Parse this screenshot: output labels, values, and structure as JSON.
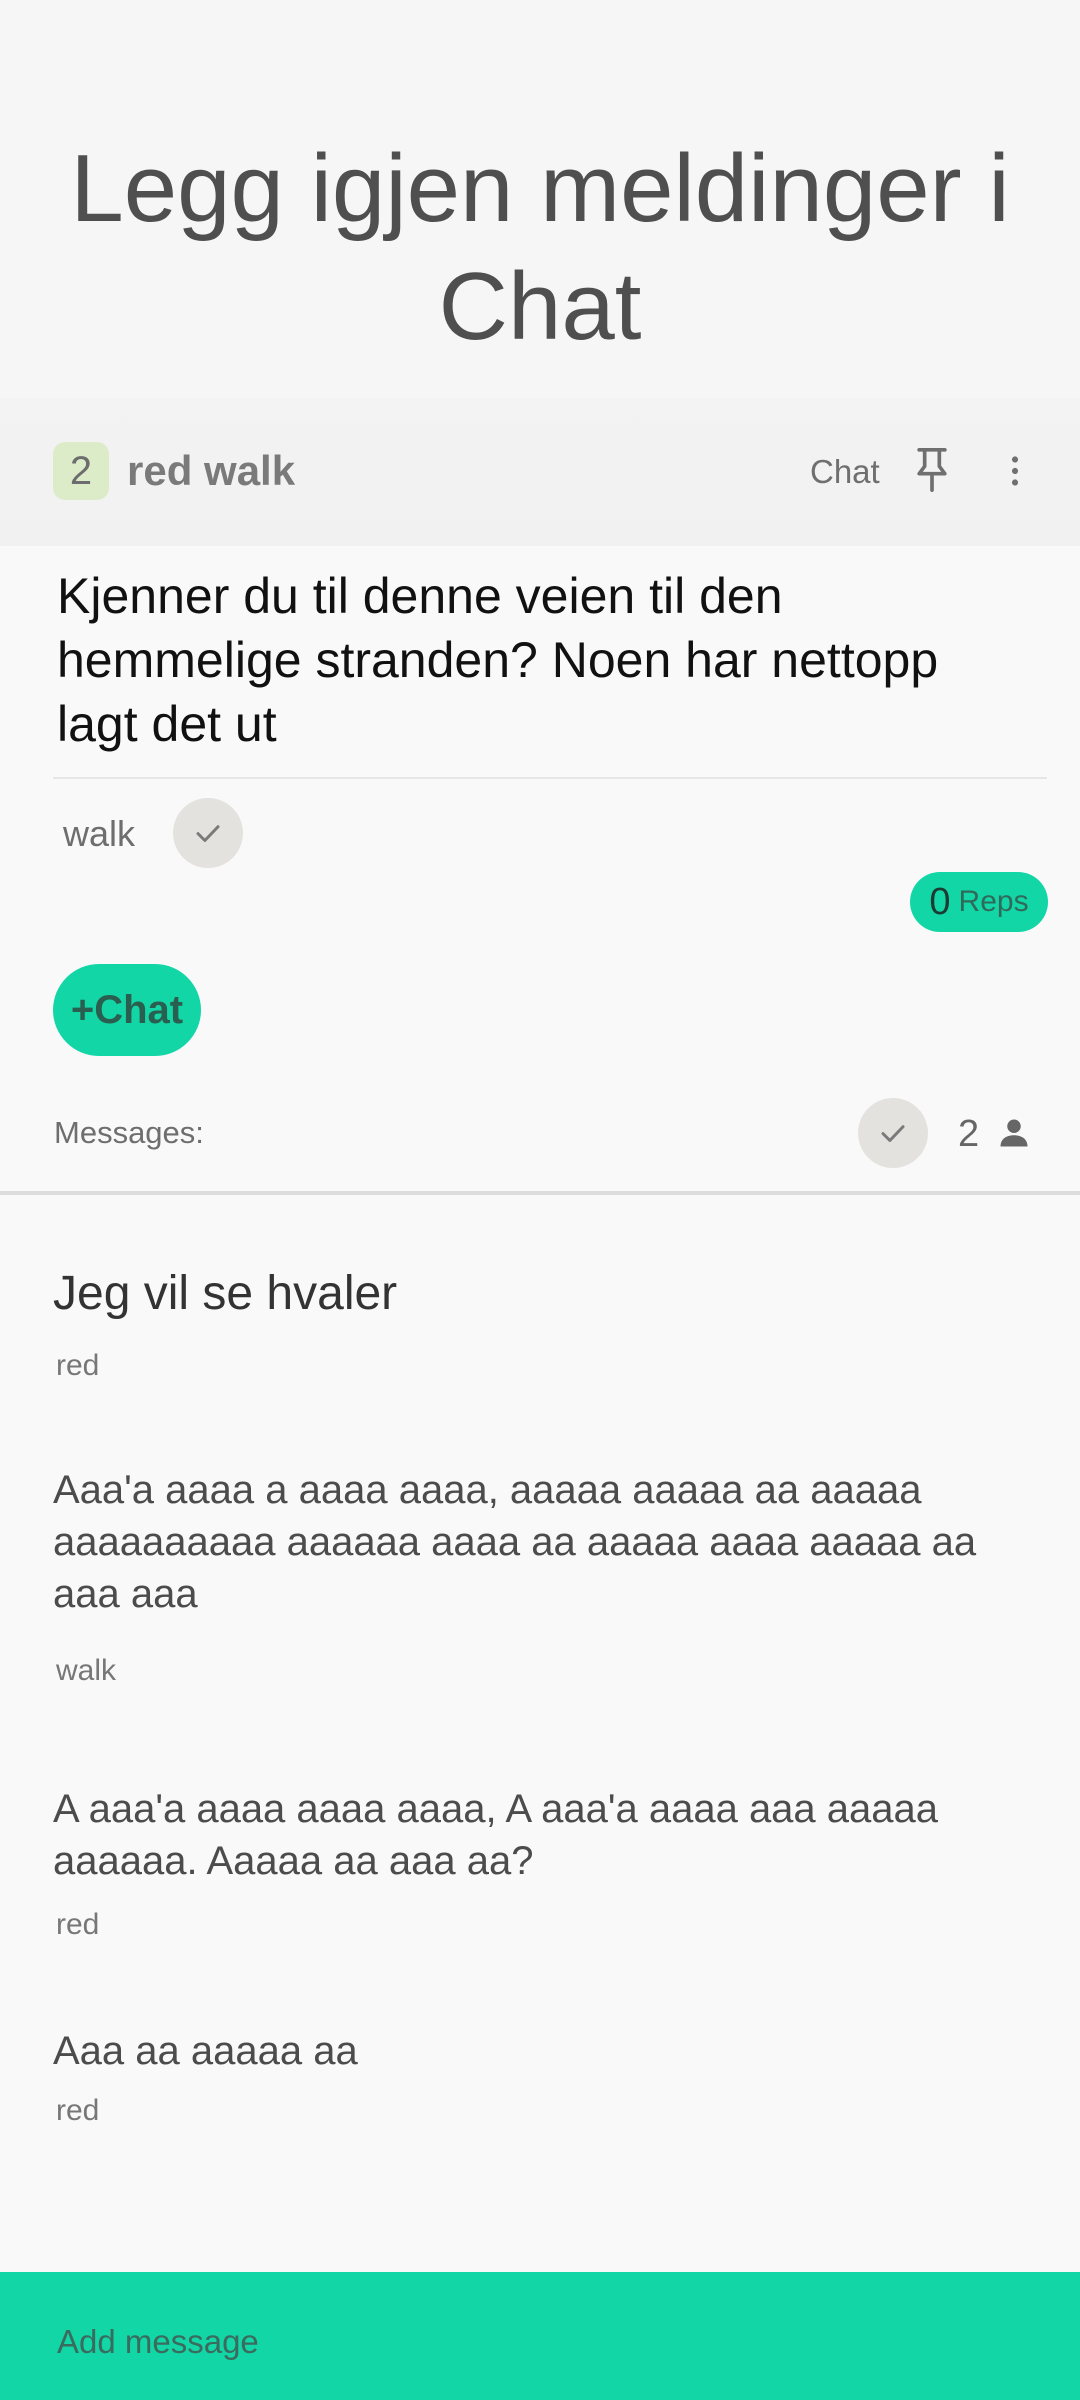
{
  "hero": {
    "title": "Legg igjen meldinger i Chat"
  },
  "app_bar": {
    "badge_count": "2",
    "title": "red walk",
    "chat_label": "Chat",
    "icons": [
      "pin-icon",
      "more-vert-icon"
    ]
  },
  "post": {
    "question": "Kjenner du til denne veien til den hemmelige stranden? Noen har nettopp lagt det ut",
    "tag": "walk",
    "reps_count": "0",
    "reps_label": "Reps",
    "chat_button": "+Chat"
  },
  "messages_header": {
    "label": "Messages:",
    "participants": "2"
  },
  "messages": [
    {
      "text": "Jeg vil se hvaler",
      "author": "red"
    },
    {
      "text": "Aaa'a aaaa a aaaa aaaa, aaaaa aaaaa aa aaaaa aaaaaaaaaa aaaaaa aaaa aa aaaaa aaaa aaaaa aa aaa aaa",
      "author": "walk"
    },
    {
      "text": "A aaa'a aaaa aaaa aaaa, A aaa'a aaaa aaa aaaaa aaaaaa. Aaaaa aa aaa aa?",
      "author": "red"
    },
    {
      "text": "Aaa aa aaaaa aa",
      "author": "red"
    }
  ],
  "input": {
    "placeholder": "Add message"
  },
  "colors": {
    "accent": "#13d6a7",
    "badge_bg": "#dcecc9",
    "background": "#f9f9f9"
  }
}
